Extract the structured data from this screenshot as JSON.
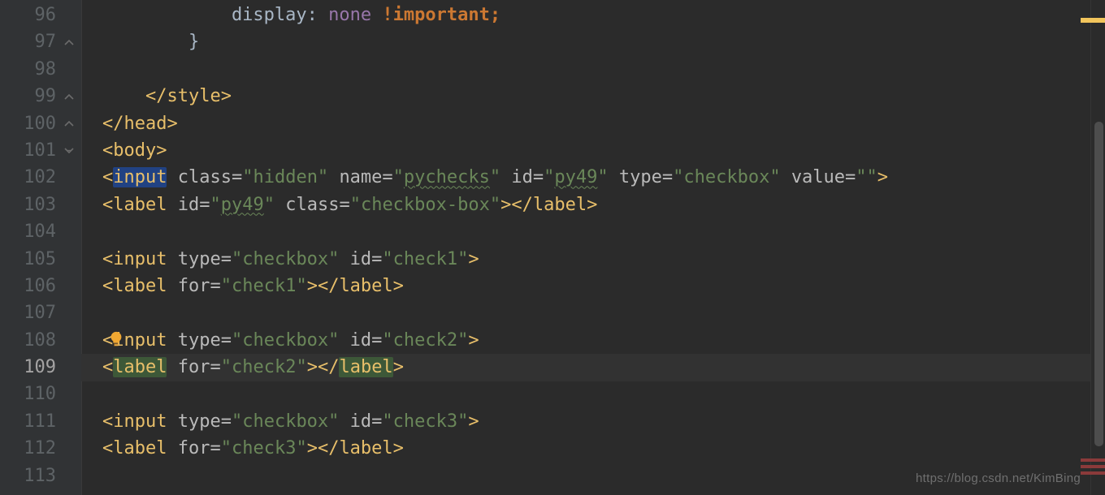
{
  "watermark": "https://blog.csdn.net/KimBing",
  "gutter": {
    "lines": [
      {
        "n": "96",
        "fold": ""
      },
      {
        "n": "97",
        "fold": "end"
      },
      {
        "n": "98",
        "fold": ""
      },
      {
        "n": "99",
        "fold": "end"
      },
      {
        "n": "100",
        "fold": "end"
      },
      {
        "n": "101",
        "fold": "open"
      },
      {
        "n": "102",
        "fold": ""
      },
      {
        "n": "103",
        "fold": ""
      },
      {
        "n": "104",
        "fold": ""
      },
      {
        "n": "105",
        "fold": ""
      },
      {
        "n": "106",
        "fold": ""
      },
      {
        "n": "107",
        "fold": ""
      },
      {
        "n": "108",
        "fold": ""
      },
      {
        "n": "109",
        "fold": "",
        "current": true
      },
      {
        "n": "110",
        "fold": ""
      },
      {
        "n": "111",
        "fold": ""
      },
      {
        "n": "112",
        "fold": ""
      },
      {
        "n": "113",
        "fold": ""
      }
    ]
  },
  "code": {
    "96": [
      {
        "cls": "c-plain",
        "t": "            display: "
      },
      {
        "cls": "c-prop",
        "t": "none"
      },
      {
        "cls": "c-plain",
        "t": " "
      },
      {
        "cls": "c-kw",
        "t": "!important"
      },
      {
        "cls": "c-kw",
        "t": ";"
      }
    ],
    "97": [
      {
        "cls": "c-plain",
        "t": "        }"
      }
    ],
    "98": [
      {
        "cls": "c-plain",
        "t": ""
      }
    ],
    "99": [
      {
        "cls": "c-plain",
        "t": "    "
      },
      {
        "cls": "c-tag",
        "t": "</style>"
      }
    ],
    "100": [
      {
        "cls": "c-tag",
        "t": "</head>"
      }
    ],
    "101": [
      {
        "cls": "c-tag",
        "t": "<body>"
      }
    ],
    "102": [
      {
        "cls": "c-tag",
        "t": "<"
      },
      {
        "cls": "c-tag c-hisel",
        "t": "input"
      },
      {
        "cls": "c-plain",
        "t": " "
      },
      {
        "cls": "c-attr",
        "t": "class"
      },
      {
        "cls": "c-punct",
        "t": "="
      },
      {
        "cls": "c-str",
        "t": "\"hidden\""
      },
      {
        "cls": "c-plain",
        "t": " "
      },
      {
        "cls": "c-attr",
        "t": "name"
      },
      {
        "cls": "c-punct",
        "t": "="
      },
      {
        "cls": "c-str",
        "t": "\""
      },
      {
        "cls": "c-str spell",
        "t": "pychecks"
      },
      {
        "cls": "c-str",
        "t": "\""
      },
      {
        "cls": "c-plain",
        "t": " "
      },
      {
        "cls": "c-attr",
        "t": "id"
      },
      {
        "cls": "c-punct",
        "t": "="
      },
      {
        "cls": "c-str",
        "t": "\""
      },
      {
        "cls": "c-str spell",
        "t": "py49"
      },
      {
        "cls": "c-str",
        "t": "\""
      },
      {
        "cls": "c-plain",
        "t": " "
      },
      {
        "cls": "c-attr",
        "t": "type"
      },
      {
        "cls": "c-punct",
        "t": "="
      },
      {
        "cls": "c-str",
        "t": "\"checkbox\""
      },
      {
        "cls": "c-plain",
        "t": " "
      },
      {
        "cls": "c-attr",
        "t": "value"
      },
      {
        "cls": "c-punct",
        "t": "="
      },
      {
        "cls": "c-str",
        "t": "\"\""
      },
      {
        "cls": "c-tag",
        "t": ">"
      }
    ],
    "103": [
      {
        "cls": "c-tag",
        "t": "<label"
      },
      {
        "cls": "c-plain",
        "t": " "
      },
      {
        "cls": "c-attr",
        "t": "id"
      },
      {
        "cls": "c-punct",
        "t": "="
      },
      {
        "cls": "c-str",
        "t": "\""
      },
      {
        "cls": "c-str spell",
        "t": "py49"
      },
      {
        "cls": "c-str",
        "t": "\""
      },
      {
        "cls": "c-plain",
        "t": " "
      },
      {
        "cls": "c-attr",
        "t": "class"
      },
      {
        "cls": "c-punct",
        "t": "="
      },
      {
        "cls": "c-str",
        "t": "\"checkbox-box\""
      },
      {
        "cls": "c-tag",
        "t": "></label>"
      }
    ],
    "104": [
      {
        "cls": "c-plain",
        "t": ""
      }
    ],
    "105": [
      {
        "cls": "c-tag",
        "t": "<input"
      },
      {
        "cls": "c-plain",
        "t": " "
      },
      {
        "cls": "c-attr",
        "t": "type"
      },
      {
        "cls": "c-punct",
        "t": "="
      },
      {
        "cls": "c-str",
        "t": "\"checkbox\""
      },
      {
        "cls": "c-plain",
        "t": " "
      },
      {
        "cls": "c-attr",
        "t": "id"
      },
      {
        "cls": "c-punct",
        "t": "="
      },
      {
        "cls": "c-str",
        "t": "\"check1\""
      },
      {
        "cls": "c-tag",
        "t": ">"
      }
    ],
    "106": [
      {
        "cls": "c-tag",
        "t": "<label"
      },
      {
        "cls": "c-plain",
        "t": " "
      },
      {
        "cls": "c-attr",
        "t": "for"
      },
      {
        "cls": "c-punct",
        "t": "="
      },
      {
        "cls": "c-str",
        "t": "\"check1\""
      },
      {
        "cls": "c-tag",
        "t": "></label>"
      }
    ],
    "107": [
      {
        "cls": "c-plain",
        "t": ""
      }
    ],
    "108": [
      {
        "cls": "c-tag",
        "t": "<input"
      },
      {
        "cls": "c-plain",
        "t": " "
      },
      {
        "cls": "c-attr",
        "t": "type"
      },
      {
        "cls": "c-punct",
        "t": "="
      },
      {
        "cls": "c-str",
        "t": "\"checkbox\""
      },
      {
        "cls": "c-plain",
        "t": " "
      },
      {
        "cls": "c-attr",
        "t": "id"
      },
      {
        "cls": "c-punct",
        "t": "="
      },
      {
        "cls": "c-str",
        "t": "\"check2\""
      },
      {
        "cls": "c-tag",
        "t": ">"
      }
    ],
    "109": [
      {
        "cls": "c-tag",
        "t": "<"
      },
      {
        "cls": "c-tag c-hiword",
        "t": "label"
      },
      {
        "cls": "c-plain",
        "t": " "
      },
      {
        "cls": "c-attr",
        "t": "for"
      },
      {
        "cls": "c-punct",
        "t": "="
      },
      {
        "cls": "c-str",
        "t": "\"check2\""
      },
      {
        "cls": "c-tag",
        "t": ">"
      },
      {
        "cls": "c-tag",
        "t": "</"
      },
      {
        "cls": "c-tag c-hiword",
        "t": "label"
      },
      {
        "cls": "c-tag",
        "t": ">"
      }
    ],
    "110": [
      {
        "cls": "c-plain",
        "t": ""
      }
    ],
    "111": [
      {
        "cls": "c-tag",
        "t": "<input"
      },
      {
        "cls": "c-plain",
        "t": " "
      },
      {
        "cls": "c-attr",
        "t": "type"
      },
      {
        "cls": "c-punct",
        "t": "="
      },
      {
        "cls": "c-str",
        "t": "\"checkbox\""
      },
      {
        "cls": "c-plain",
        "t": " "
      },
      {
        "cls": "c-attr",
        "t": "id"
      },
      {
        "cls": "c-punct",
        "t": "="
      },
      {
        "cls": "c-str",
        "t": "\"check3\""
      },
      {
        "cls": "c-tag",
        "t": ">"
      }
    ],
    "112": [
      {
        "cls": "c-tag",
        "t": "<label"
      },
      {
        "cls": "c-plain",
        "t": " "
      },
      {
        "cls": "c-attr",
        "t": "for"
      },
      {
        "cls": "c-punct",
        "t": "="
      },
      {
        "cls": "c-str",
        "t": "\"check3\""
      },
      {
        "cls": "c-tag",
        "t": "></label>"
      }
    ],
    "113": [
      {
        "cls": "c-plain",
        "t": ""
      }
    ]
  }
}
